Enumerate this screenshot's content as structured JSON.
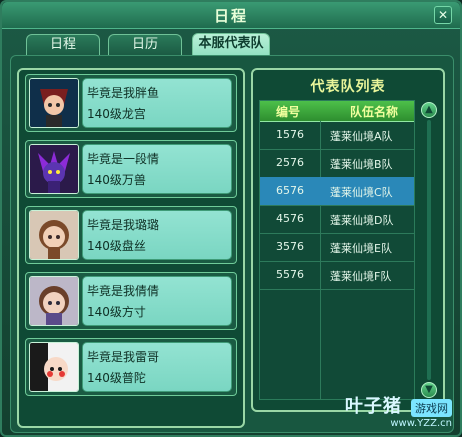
{
  "window": {
    "title": "日程"
  },
  "tabs": [
    {
      "label": "日程",
      "active": false
    },
    {
      "label": "日历",
      "active": false
    },
    {
      "label": "本服代表队",
      "active": true
    }
  ],
  "members": [
    {
      "name": "毕竟是我胖鱼",
      "level": "140级龙宫",
      "avatar_icon": "avatar-warrior-icon"
    },
    {
      "name": "毕竟是一段情",
      "level": "140级万兽",
      "avatar_icon": "avatar-demon-icon"
    },
    {
      "name": "毕竟是我璐璐",
      "level": "140级盘丝",
      "avatar_icon": "avatar-girl-icon"
    },
    {
      "name": "毕竟是我倩倩",
      "level": "140级方寸",
      "avatar_icon": "avatar-girl2-icon"
    },
    {
      "name": "毕竟是我雷哥",
      "level": "140级普陀",
      "avatar_icon": "avatar-joker-icon"
    }
  ],
  "team_list": {
    "title": "代表队列表",
    "headers": {
      "id": "编号",
      "name": "队伍名称"
    },
    "rows": [
      {
        "id": "1576",
        "name": "蓬莱仙境A队",
        "selected": false
      },
      {
        "id": "2576",
        "name": "蓬莱仙境B队",
        "selected": false
      },
      {
        "id": "6576",
        "name": "蓬莱仙境C队",
        "selected": true
      },
      {
        "id": "4576",
        "name": "蓬莱仙境D队",
        "selected": false
      },
      {
        "id": "3576",
        "name": "蓬莱仙境E队",
        "selected": false
      },
      {
        "id": "5576",
        "name": "蓬莱仙境F队",
        "selected": false
      }
    ]
  },
  "watermark": {
    "brand": "叶子猪",
    "badge": "游戏网",
    "url": "www.YZZ.cn"
  },
  "colors": {
    "accent": "#2a88b8",
    "header_green": "#4dc04a",
    "card": "#93e3d2"
  }
}
